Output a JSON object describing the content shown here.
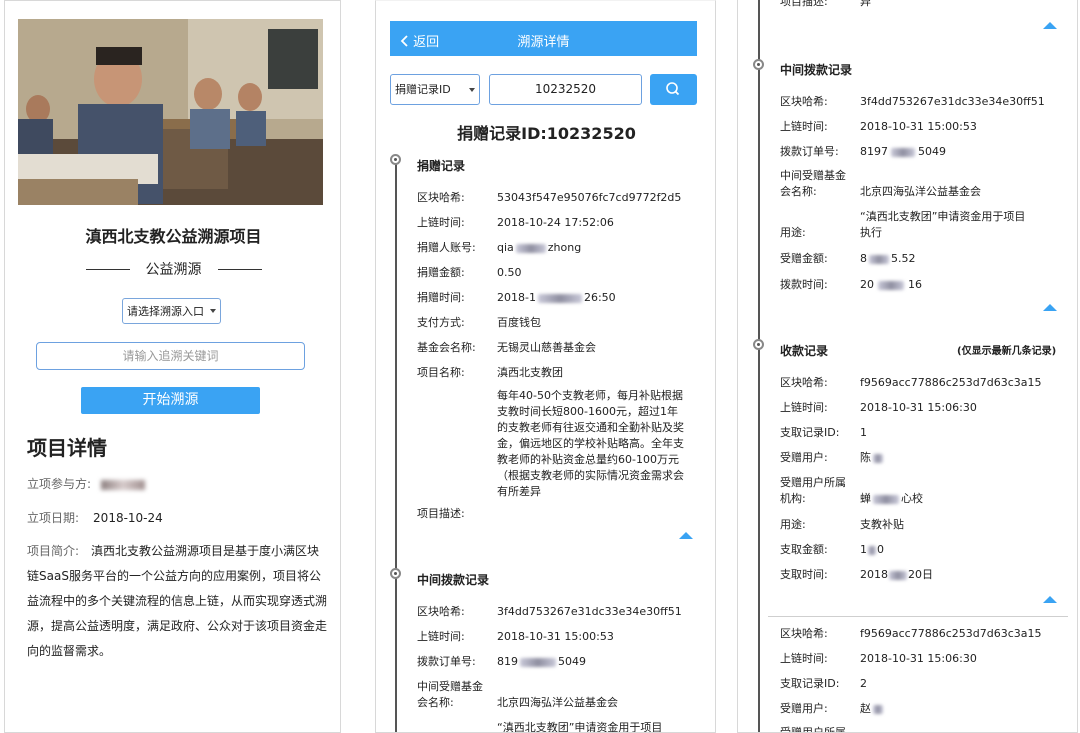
{
  "panel1": {
    "project_title": "滇西北支教公益溯源项目",
    "subtitle": "公益溯源",
    "select_placeholder": "请选择溯源入口",
    "keyword_placeholder": "请输入追溯关键词",
    "start_button": "开始溯源",
    "detail_heading": "项目详情",
    "participant_label": "立项参与方:",
    "date_label": "立项日期:",
    "date_value": "2018-10-24",
    "intro_label": "项目简介:",
    "intro_text": "滇西北支教公益溯源项目是基于度小满区块链SaaS服务平台的一个公益方向的应用案例，项目将公益流程中的多个关键流程的信息上链，从而实现穿透式溯源，提高公益透明度，满足政府、公众对于该项目资金走向的监督需求。"
  },
  "panel2": {
    "back_label": "返回",
    "header_title": "溯源详情",
    "select_value": "捐赠记录ID",
    "id_value": "10232520",
    "record_title": "捐赠记录ID:10232520",
    "donation": {
      "heading": "捐赠记录",
      "rows": [
        {
          "k": "区块哈希:",
          "v": "53043f547e95076fc7cd9772f2d5"
        },
        {
          "k": "上链时间:",
          "v": "2018-10-24 17:52:06"
        },
        {
          "k": "捐赠人账号:",
          "v": "qia",
          "v2": "zhong"
        },
        {
          "k": "捐赠金额:",
          "v": "0.50"
        },
        {
          "k": "捐赠时间:",
          "v": "2018-1",
          "v2": "26:50"
        },
        {
          "k": "支付方式:",
          "v": "百度钱包"
        },
        {
          "k": "基金会名称:",
          "v": "无锡灵山慈善基金会"
        },
        {
          "k": "项目名称:",
          "v": "滇西北支教团"
        }
      ],
      "desc_label": "项目描述:",
      "desc_text": "每年40-50个支教老师，每月补贴根据支教时间长短800-1600元，超过1年的支教老师有往返交通和全勤补贴及奖金，偏远地区的学校补贴略高。全年支教老师的补贴资金总量约60-100万元（根据支教老师的实际情况资金需求会有所差异"
    },
    "transfer": {
      "heading": "中间拨款记录",
      "rows": [
        {
          "k": "区块哈希:",
          "v": "3f4dd753267e31dc33e34e30ff51"
        },
        {
          "k": "上链时间:",
          "v": "2018-10-31 15:00:53"
        },
        {
          "k": "拨款订单号:",
          "v": "819",
          "v2": "5049"
        }
      ],
      "foundation_label_1": "中间受赠基金",
      "foundation_label_2": "会名称:",
      "foundation_value": "北京四海弘洋公益基金会",
      "purpose_value": "“滇西北支教团”申请资金用于项目"
    }
  },
  "panel3": {
    "top_label": "项目描述:",
    "top_value": "异",
    "transfer": {
      "heading": "中间拨款记录",
      "rows": [
        {
          "k": "区块哈希:",
          "v": "3f4dd753267e31dc33e34e30ff51"
        },
        {
          "k": "上链时间:",
          "v": "2018-10-31 15:00:53"
        },
        {
          "k": "拨款订单号:",
          "v": "8197",
          "v2": "5049"
        }
      ],
      "foundation_label_1": "中间受赠基金",
      "foundation_label_2": "会名称:",
      "foundation_value": "北京四海弘洋公益基金会",
      "purpose_line1": "“滇西北支教团”申请资金用于项目",
      "purpose_label": "用途:",
      "purpose_line2": "执行",
      "amount_label": "受赠金额:",
      "amount_v1": "8",
      "amount_v2": "5.52",
      "time_label": "拨款时间:",
      "time_v1": "20",
      "time_v2": "16"
    },
    "receipt": {
      "heading": "收款记录",
      "note": "(仅显示最新几条记录)",
      "rows1": [
        {
          "k": "区块哈希:",
          "v": "f9569acc77886c253d7d63c3a15"
        },
        {
          "k": "上链时间:",
          "v": "2018-10-31 15:06:30"
        },
        {
          "k": "支取记录ID:",
          "v": "1"
        },
        {
          "k": "受赠用户:",
          "v": "陈"
        }
      ],
      "org_label_1": "受赠用户所属",
      "org_label_2": "机构:",
      "org_v1": "蝉",
      "org_v2": "心校",
      "rows2": [
        {
          "k": "用途:",
          "v": "支教补贴"
        },
        {
          "k": "支取金额:",
          "v": "1",
          "v2": "0"
        },
        {
          "k": "支取时间:",
          "v": "2018",
          "v2": "20日"
        }
      ],
      "rows3": [
        {
          "k": "区块哈希:",
          "v": "f9569acc77886c253d7d63c3a15"
        },
        {
          "k": "上链时间:",
          "v": "2018-10-31 15:06:30"
        },
        {
          "k": "支取记录ID:",
          "v": "2"
        },
        {
          "k": "受赠用户:",
          "v": "赵"
        }
      ],
      "last_label": "受赠用户所属"
    }
  }
}
